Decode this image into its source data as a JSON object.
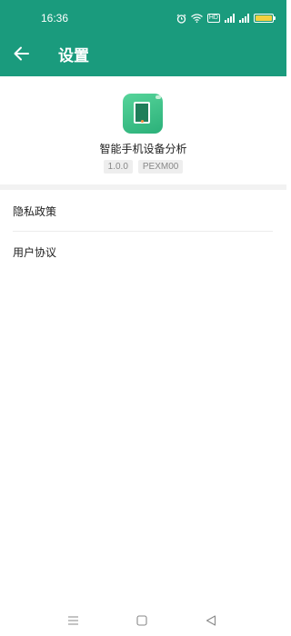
{
  "status_bar": {
    "time": "16:36",
    "hd_badge": "HD",
    "signal_label": "4G",
    "battery_color": "#f3d040"
  },
  "header": {
    "title": "设置",
    "background": "#1a9b7d"
  },
  "app": {
    "name": "智能手机设备分析",
    "version": "1.0.0",
    "model": "PEXM00"
  },
  "menu": {
    "privacy_policy": "隐私政策",
    "user_agreement": "用户协议"
  },
  "icons": {
    "back": "arrow-left",
    "nav_menu": "three-lines",
    "nav_home": "square",
    "nav_back": "triangle-left"
  }
}
